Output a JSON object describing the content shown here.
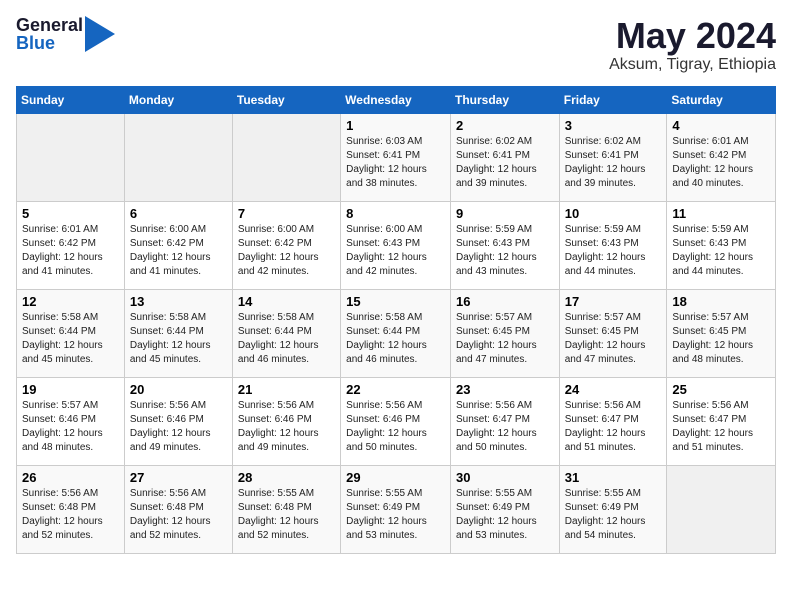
{
  "logo": {
    "general": "General",
    "blue": "Blue"
  },
  "title": "May 2024",
  "subtitle": "Aksum, Tigray, Ethiopia",
  "days_header": [
    "Sunday",
    "Monday",
    "Tuesday",
    "Wednesday",
    "Thursday",
    "Friday",
    "Saturday"
  ],
  "weeks": [
    [
      {
        "day": "",
        "info": ""
      },
      {
        "day": "",
        "info": ""
      },
      {
        "day": "",
        "info": ""
      },
      {
        "day": "1",
        "info": "Sunrise: 6:03 AM\nSunset: 6:41 PM\nDaylight: 12 hours\nand 38 minutes."
      },
      {
        "day": "2",
        "info": "Sunrise: 6:02 AM\nSunset: 6:41 PM\nDaylight: 12 hours\nand 39 minutes."
      },
      {
        "day": "3",
        "info": "Sunrise: 6:02 AM\nSunset: 6:41 PM\nDaylight: 12 hours\nand 39 minutes."
      },
      {
        "day": "4",
        "info": "Sunrise: 6:01 AM\nSunset: 6:42 PM\nDaylight: 12 hours\nand 40 minutes."
      }
    ],
    [
      {
        "day": "5",
        "info": "Sunrise: 6:01 AM\nSunset: 6:42 PM\nDaylight: 12 hours\nand 41 minutes."
      },
      {
        "day": "6",
        "info": "Sunrise: 6:00 AM\nSunset: 6:42 PM\nDaylight: 12 hours\nand 41 minutes."
      },
      {
        "day": "7",
        "info": "Sunrise: 6:00 AM\nSunset: 6:42 PM\nDaylight: 12 hours\nand 42 minutes."
      },
      {
        "day": "8",
        "info": "Sunrise: 6:00 AM\nSunset: 6:43 PM\nDaylight: 12 hours\nand 42 minutes."
      },
      {
        "day": "9",
        "info": "Sunrise: 5:59 AM\nSunset: 6:43 PM\nDaylight: 12 hours\nand 43 minutes."
      },
      {
        "day": "10",
        "info": "Sunrise: 5:59 AM\nSunset: 6:43 PM\nDaylight: 12 hours\nand 44 minutes."
      },
      {
        "day": "11",
        "info": "Sunrise: 5:59 AM\nSunset: 6:43 PM\nDaylight: 12 hours\nand 44 minutes."
      }
    ],
    [
      {
        "day": "12",
        "info": "Sunrise: 5:58 AM\nSunset: 6:44 PM\nDaylight: 12 hours\nand 45 minutes."
      },
      {
        "day": "13",
        "info": "Sunrise: 5:58 AM\nSunset: 6:44 PM\nDaylight: 12 hours\nand 45 minutes."
      },
      {
        "day": "14",
        "info": "Sunrise: 5:58 AM\nSunset: 6:44 PM\nDaylight: 12 hours\nand 46 minutes."
      },
      {
        "day": "15",
        "info": "Sunrise: 5:58 AM\nSunset: 6:44 PM\nDaylight: 12 hours\nand 46 minutes."
      },
      {
        "day": "16",
        "info": "Sunrise: 5:57 AM\nSunset: 6:45 PM\nDaylight: 12 hours\nand 47 minutes."
      },
      {
        "day": "17",
        "info": "Sunrise: 5:57 AM\nSunset: 6:45 PM\nDaylight: 12 hours\nand 47 minutes."
      },
      {
        "day": "18",
        "info": "Sunrise: 5:57 AM\nSunset: 6:45 PM\nDaylight: 12 hours\nand 48 minutes."
      }
    ],
    [
      {
        "day": "19",
        "info": "Sunrise: 5:57 AM\nSunset: 6:46 PM\nDaylight: 12 hours\nand 48 minutes."
      },
      {
        "day": "20",
        "info": "Sunrise: 5:56 AM\nSunset: 6:46 PM\nDaylight: 12 hours\nand 49 minutes."
      },
      {
        "day": "21",
        "info": "Sunrise: 5:56 AM\nSunset: 6:46 PM\nDaylight: 12 hours\nand 49 minutes."
      },
      {
        "day": "22",
        "info": "Sunrise: 5:56 AM\nSunset: 6:46 PM\nDaylight: 12 hours\nand 50 minutes."
      },
      {
        "day": "23",
        "info": "Sunrise: 5:56 AM\nSunset: 6:47 PM\nDaylight: 12 hours\nand 50 minutes."
      },
      {
        "day": "24",
        "info": "Sunrise: 5:56 AM\nSunset: 6:47 PM\nDaylight: 12 hours\nand 51 minutes."
      },
      {
        "day": "25",
        "info": "Sunrise: 5:56 AM\nSunset: 6:47 PM\nDaylight: 12 hours\nand 51 minutes."
      }
    ],
    [
      {
        "day": "26",
        "info": "Sunrise: 5:56 AM\nSunset: 6:48 PM\nDaylight: 12 hours\nand 52 minutes."
      },
      {
        "day": "27",
        "info": "Sunrise: 5:56 AM\nSunset: 6:48 PM\nDaylight: 12 hours\nand 52 minutes."
      },
      {
        "day": "28",
        "info": "Sunrise: 5:55 AM\nSunset: 6:48 PM\nDaylight: 12 hours\nand 52 minutes."
      },
      {
        "day": "29",
        "info": "Sunrise: 5:55 AM\nSunset: 6:49 PM\nDaylight: 12 hours\nand 53 minutes."
      },
      {
        "day": "30",
        "info": "Sunrise: 5:55 AM\nSunset: 6:49 PM\nDaylight: 12 hours\nand 53 minutes."
      },
      {
        "day": "31",
        "info": "Sunrise: 5:55 AM\nSunset: 6:49 PM\nDaylight: 12 hours\nand 54 minutes."
      },
      {
        "day": "",
        "info": ""
      }
    ]
  ]
}
